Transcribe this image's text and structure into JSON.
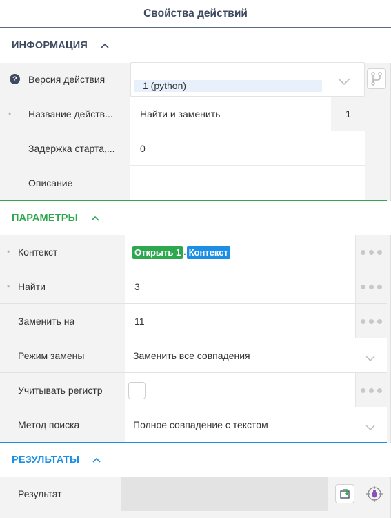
{
  "panel": {
    "title": "Свойства действий"
  },
  "info": {
    "header": "ИНФОРМАЦИЯ",
    "version_label": "Версия действия",
    "version_value": "1 (python)",
    "name_label": "Название действ...",
    "name_value": "Найти и заменить",
    "name_counter": "1",
    "delay_label": "Задержка старта,...",
    "delay_value": "0",
    "description_label": "Описание",
    "description_value": ""
  },
  "params": {
    "header": "ПАРАМЕТРЫ",
    "context_label": "Контекст",
    "context_tag1": "Открыть 1",
    "context_dot": ".",
    "context_tag2": "Контекст",
    "find_label": "Найти",
    "find_value": "3",
    "replace_label": "Заменить на",
    "replace_value": "11",
    "mode_label": "Режим замены",
    "mode_value": "Заменить все совпадения",
    "case_label": "Учитывать регистр",
    "case_checked": false,
    "method_label": "Метод поиска",
    "method_value": "Полное совпадение с текстом"
  },
  "results": {
    "header": "РЕЗУЛЬТАТЫ",
    "result_label": "Результат",
    "result_value": ""
  },
  "colors": {
    "info": "#3d4a60",
    "params": "#2ea84e",
    "results": "#1b8fe6"
  }
}
